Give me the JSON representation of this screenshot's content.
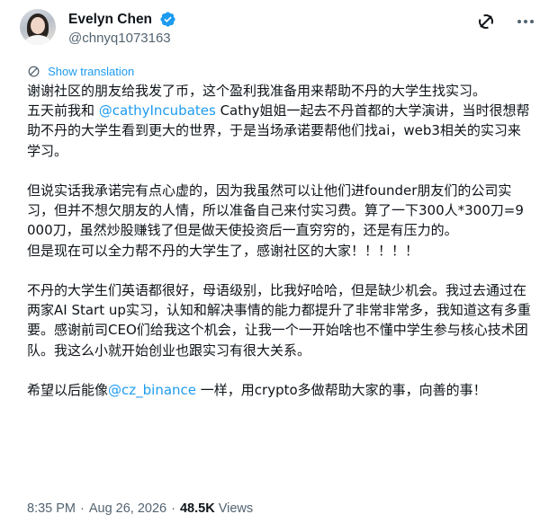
{
  "author": {
    "display_name": "Evelyn Chen",
    "handle": "@chnyq1073163",
    "verified": true,
    "avatar_icon": "avatar-photo"
  },
  "header_actions": {
    "grok_icon": "grok-icon",
    "more_icon": "more-dots-icon"
  },
  "translate": {
    "label": "Show translation",
    "icon": "translate-icon"
  },
  "tweet": {
    "p1": "谢谢社区的朋友给我发了币，这个盈利我准备用来帮助不丹的大学生找实习。",
    "p2_before": "五天前我和 ",
    "p2_mention": "@cathyIncubates",
    "p2_after": " Cathy姐姐一起去不丹首都的大学演讲，当时很想帮助不丹的大学生看到更大的世界，于是当场承诺要帮他们找ai，web3相关的实习来学习。",
    "p3": "但说实话我承诺完有点心虚的，因为我虽然可以让他们进founder朋友们的公司实习，但并不想欠朋友的人情，所以准备自己来付实习费。算了一下300人*300刀=9000刀，虽然炒股赚钱了但是做天使投资后一直穷穷的，还是有压力的。",
    "p4": "但是现在可以全力帮不丹的大学生了，感谢社区的大家！！！！！",
    "p5": "不丹的大学生们英语都很好，母语级别，比我好哈哈，但是缺少机会。我过去通过在两家AI Start up实习，认知和解决事情的能力都提升了非常非常多，我知道这有多重要。感谢前司CEO们给我这个机会，让我一个一开始啥也不懂中学生参与核心技术团队。我这么小就开始创业也跟实习有很大关系。",
    "p6_before": "希望以后能像",
    "p6_mention": "@cz_binance",
    "p6_after": " 一样，用crypto多做帮助大家的事，向善的事！"
  },
  "meta": {
    "time": "8:35 PM",
    "separator": "·",
    "date": "Aug 26, 2026",
    "views_count": "48.5K",
    "views_label": "Views"
  },
  "colors": {
    "text": "#0f1419",
    "secondary": "#536471",
    "accent": "#1d9bf0"
  }
}
